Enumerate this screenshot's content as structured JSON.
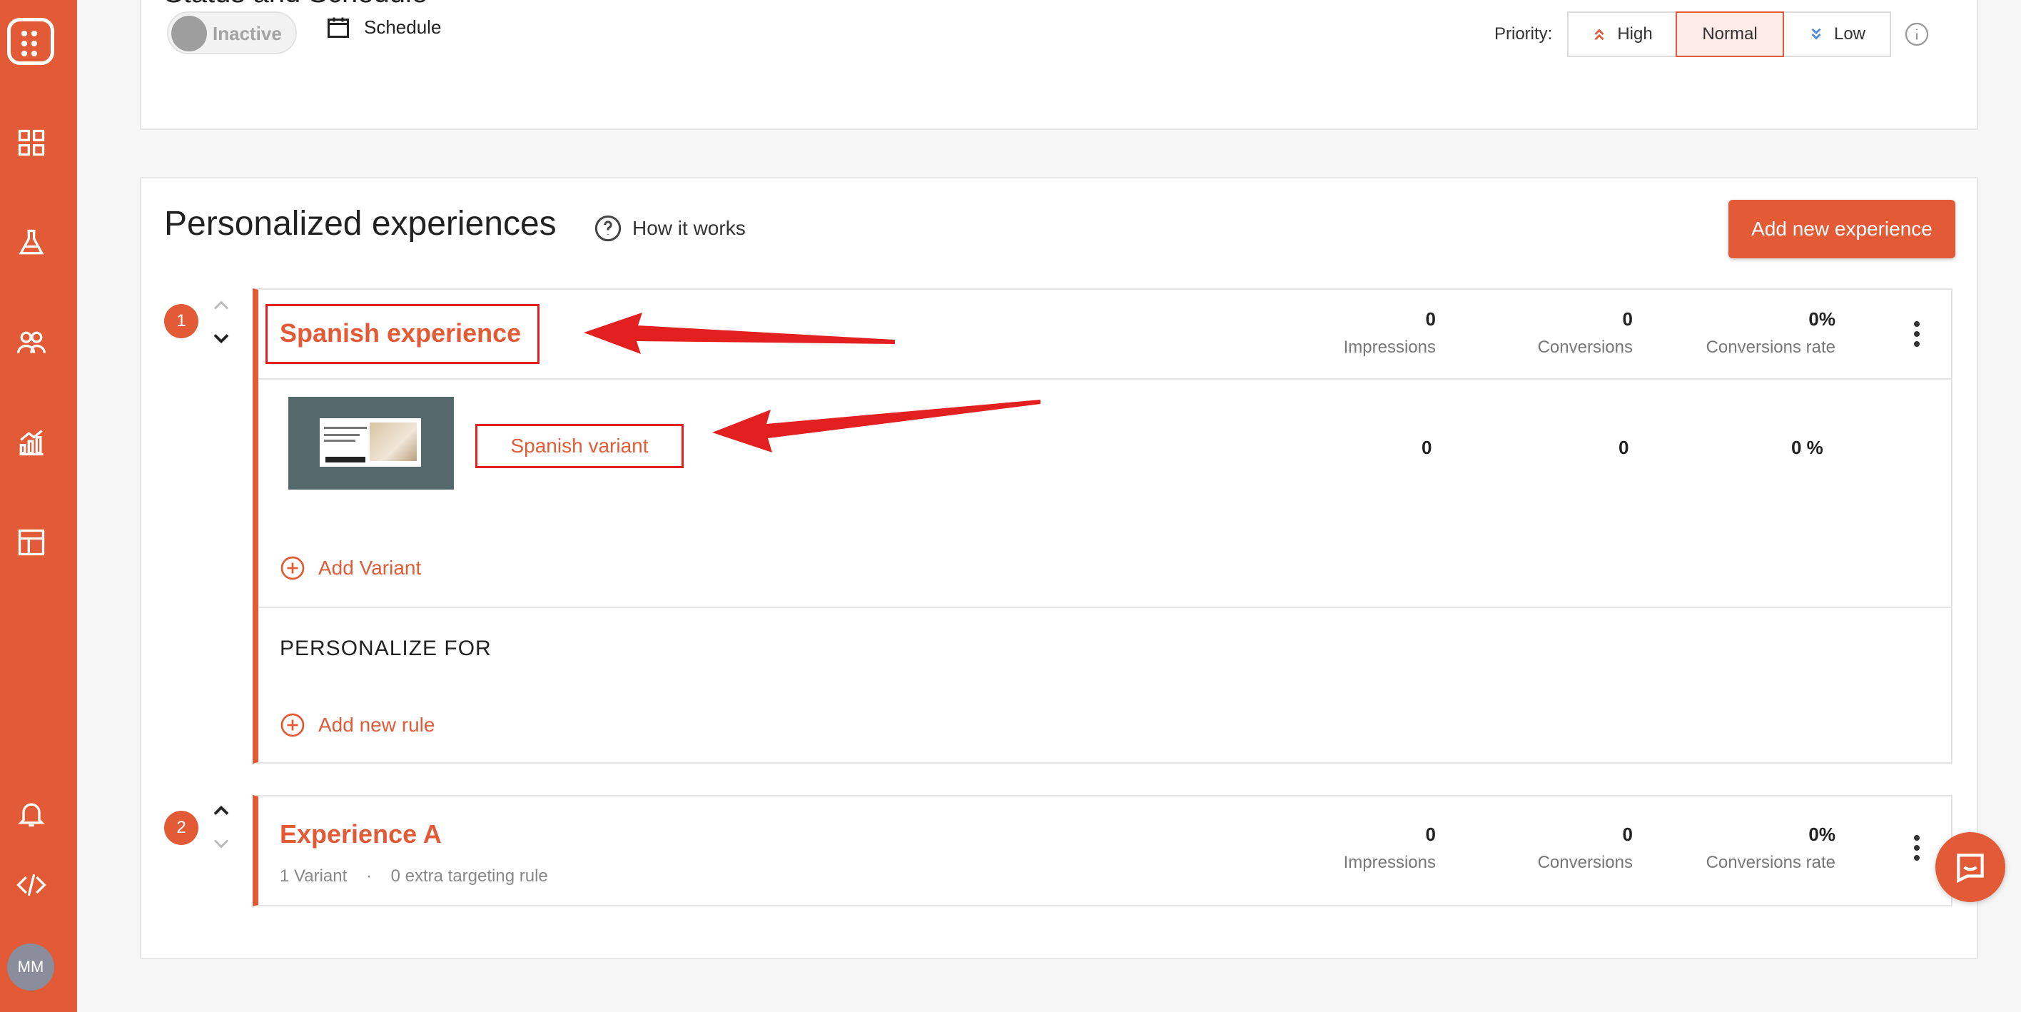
{
  "sidebar": {
    "items": [
      {
        "icon": "grid-icon"
      },
      {
        "icon": "flask-icon"
      },
      {
        "icon": "users-icon"
      },
      {
        "icon": "analytics-icon"
      },
      {
        "icon": "layout-icon"
      }
    ],
    "bottom": {
      "notifications_icon": "bell-icon",
      "code_icon": "code-icon",
      "avatar": "MM"
    }
  },
  "status": {
    "title": "Status and Schedule",
    "toggle_label": "Inactive",
    "schedule_label": "Schedule",
    "priority_label": "Priority:",
    "priority_options": {
      "high": "High",
      "normal": "Normal",
      "low": "Low"
    },
    "priority_selected": "Normal"
  },
  "experiences": {
    "title": "Personalized experiences",
    "how_it_works": "How it works",
    "add_button": "Add new experience",
    "items": [
      {
        "number": "1",
        "name": "Spanish experience",
        "impressions": "0",
        "impressions_label": "Impressions",
        "conversions": "0",
        "conversions_label": "Conversions",
        "rate": "0%",
        "rate_label": "Conversions rate",
        "variant": {
          "name": "Spanish variant",
          "impressions": "0",
          "conversions": "0",
          "rate": "0 %"
        },
        "add_variant": "Add Variant",
        "personalize_for": "PERSONALIZE FOR",
        "add_rule": "Add new rule"
      },
      {
        "number": "2",
        "name": "Experience A",
        "variants": "1 Variant",
        "separator": "·",
        "rules": "0 extra targeting rule",
        "impressions": "0",
        "impressions_label": "Impressions",
        "conversions": "0",
        "conversions_label": "Conversions",
        "rate": "0%",
        "rate_label": "Conversions rate"
      }
    ]
  },
  "colors": {
    "accent": "#e25b36",
    "annotation": "#e22020"
  }
}
